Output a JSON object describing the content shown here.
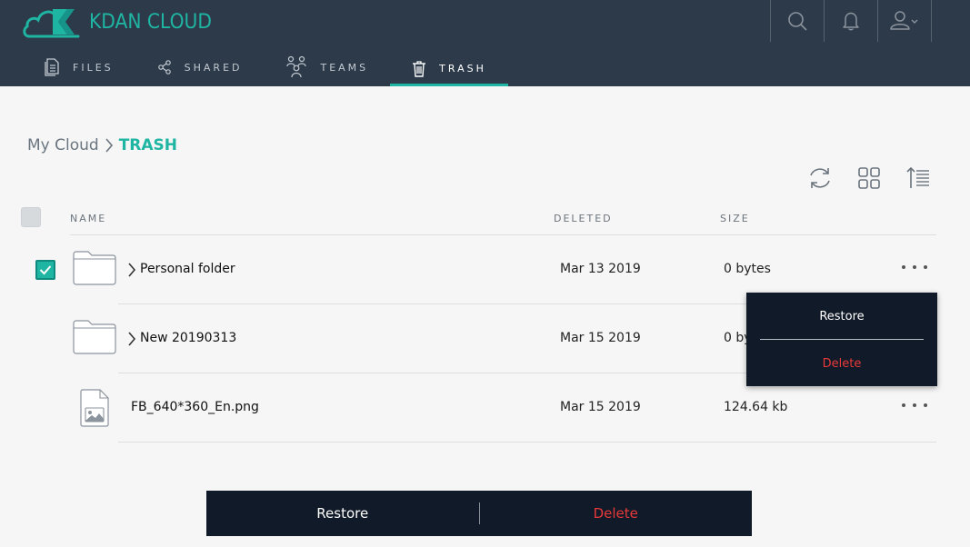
{
  "brand": {
    "logo_text": "KDAN CLOUD",
    "accent": "#1fb5a3",
    "header_bg": "#2c3a4a"
  },
  "header": {
    "icons": [
      "search-icon",
      "bell-icon",
      "user-icon"
    ]
  },
  "tabs": [
    {
      "label": "FILES",
      "icon": "document-icon",
      "active": false
    },
    {
      "label": "SHARED",
      "icon": "share-icon",
      "active": false
    },
    {
      "label": "TEAMS",
      "icon": "team-icon",
      "active": false
    },
    {
      "label": "TRASH",
      "icon": "trash-icon",
      "active": true
    }
  ],
  "breadcrumb": {
    "root": "My Cloud",
    "current": "TRASH"
  },
  "toolbar": {
    "icons": [
      "refresh-icon",
      "grid-view-icon",
      "sort-icon"
    ]
  },
  "columns": {
    "name": "NAME",
    "deleted": "DELETED",
    "size": "SIZE"
  },
  "rows": [
    {
      "name": "Personal folder",
      "type": "folder",
      "deleted": "Mar 13 2019",
      "size": "0 bytes",
      "selected": true
    },
    {
      "name": "New 20190313",
      "type": "folder",
      "deleted": "Mar 15 2019",
      "size": "0 by",
      "selected": false
    },
    {
      "name": "FB_640*360_En.png",
      "type": "image",
      "deleted": "Mar 15 2019",
      "size": "124.64 kb",
      "selected": false
    }
  ],
  "context_menu": {
    "restore": "Restore",
    "delete": "Delete"
  },
  "action_bar": {
    "restore": "Restore",
    "delete": "Delete"
  },
  "colors": {
    "danger": "#e83a3a",
    "menu_bg": "#101a28"
  }
}
